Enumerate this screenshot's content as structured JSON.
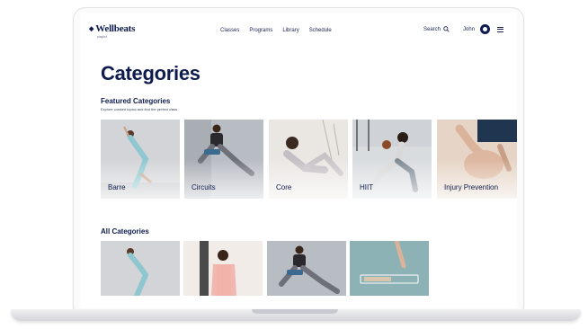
{
  "app": {
    "brand": "Wellbeats",
    "brand_sub": "playlist",
    "nav": [
      "Classes",
      "Programs",
      "Library",
      "Schedule"
    ],
    "search_label": "Search",
    "user_name": "John"
  },
  "page": {
    "title": "Categories",
    "featured": {
      "title": "Featured Categories",
      "subtitle": "Explore curated topics and find the perfect class",
      "cards": [
        "Barre",
        "Circuits",
        "Core",
        "HIIT",
        "Injury Prevention"
      ]
    },
    "all": {
      "title": "All Categories"
    }
  },
  "colors": {
    "navy": "#0e1b4d",
    "barre_bg": "#d3d4d7",
    "circuits_bg": "#b8bcc3",
    "core_bg": "#eae7e3",
    "hiit_bg": "#d9dcdf",
    "injury_bg": "#e6d5c6",
    "teal_bg": "#8db2b5"
  },
  "icons": [
    "search-icon",
    "avatar-icon",
    "menu-icon"
  ]
}
